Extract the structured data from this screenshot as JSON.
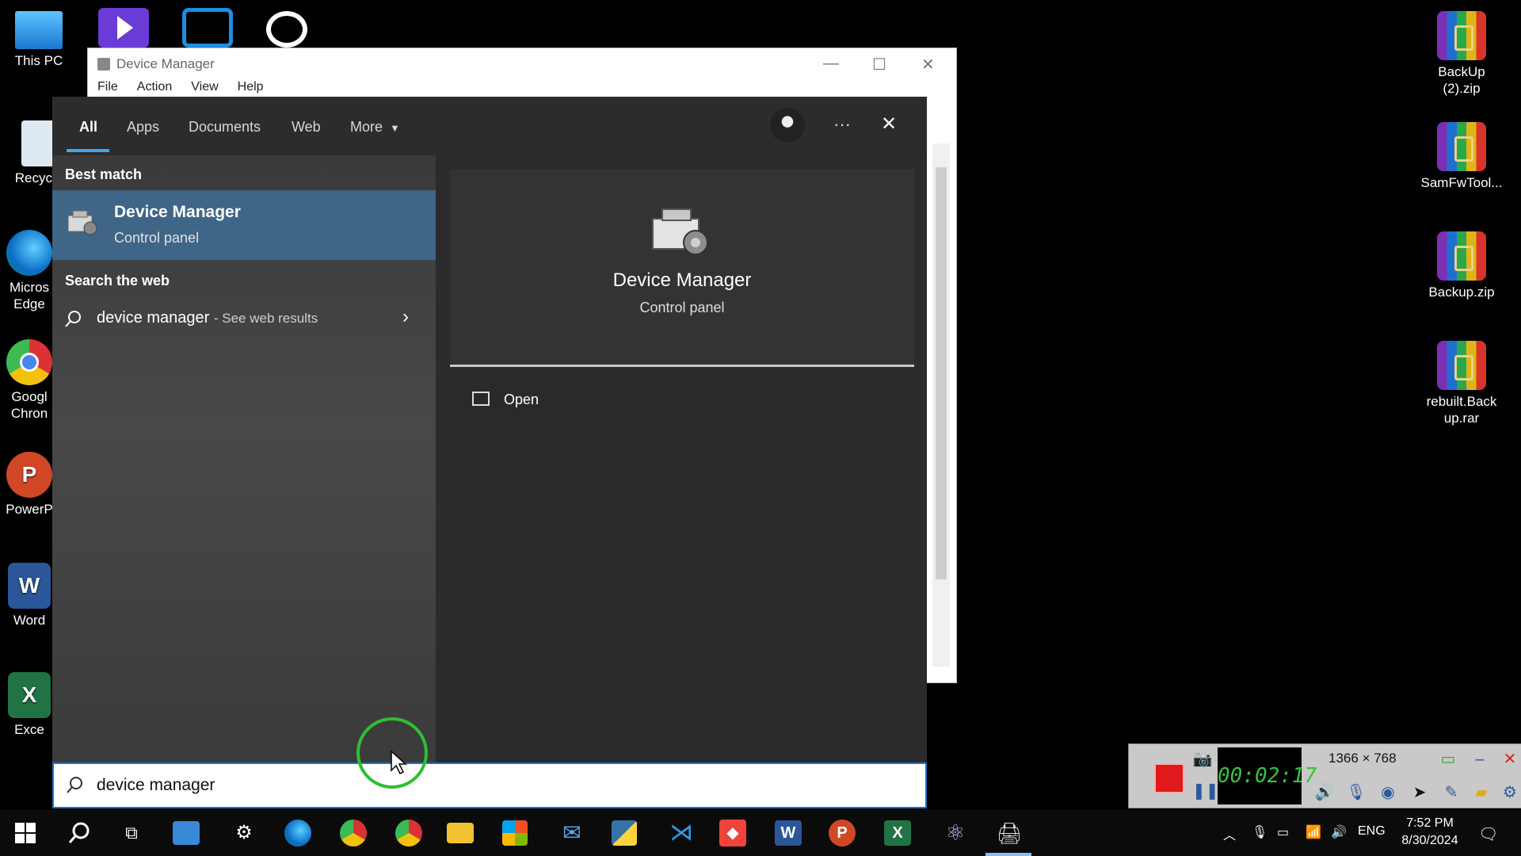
{
  "desktop": {
    "left_icons": [
      {
        "label": "This PC",
        "icon": "this-pc-icon"
      },
      {
        "label": "Recycle",
        "icon": "recycle-bin-icon"
      },
      {
        "label": "Micros\nEdge",
        "icon": "edge-icon"
      },
      {
        "label": "Googl\nChron",
        "icon": "chrome-icon"
      },
      {
        "label": "PowerP",
        "icon": "powerpoint-icon"
      },
      {
        "label": "Word",
        "icon": "word-icon"
      },
      {
        "label": "Exce",
        "icon": "excel-icon"
      }
    ],
    "right_icons": [
      {
        "label": "BackUp\n(2).zip",
        "icon": "winrar-archive-icon"
      },
      {
        "label": "SamFwTool...",
        "icon": "winrar-archive-icon"
      },
      {
        "label": "Backup.zip",
        "icon": "winrar-archive-icon"
      },
      {
        "label": "rebuilt.Back\nup.rar",
        "icon": "winrar-archive-icon"
      }
    ]
  },
  "device_manager_window": {
    "title": "Device Manager",
    "menu": [
      "File",
      "Action",
      "View",
      "Help"
    ]
  },
  "search_panel": {
    "tabs": [
      {
        "label": "All",
        "active": true
      },
      {
        "label": "Apps"
      },
      {
        "label": "Documents"
      },
      {
        "label": "Web"
      },
      {
        "label": "More"
      }
    ],
    "best_match_heading": "Best match",
    "best_match": {
      "title": "Device Manager",
      "subtitle": "Control panel"
    },
    "web_heading": "Search the web",
    "web_result": {
      "query": "device manager",
      "suffix": "- See web results"
    },
    "detail": {
      "title": "Device Manager",
      "subtitle": "Control panel",
      "action_open": "Open"
    },
    "search_query": "device manager"
  },
  "recorder": {
    "timer": "00:02:17",
    "resolution": "1366 × 768"
  },
  "taskbar": {
    "language": "ENG",
    "time": "7:52 PM",
    "date": "8/30/2024"
  },
  "colors": {
    "accent": "#4aa3e8",
    "selected_row": "#3f6587",
    "search_border": "#1e73c8",
    "recording": "#e01a1a",
    "timer_text": "#35c33b"
  }
}
